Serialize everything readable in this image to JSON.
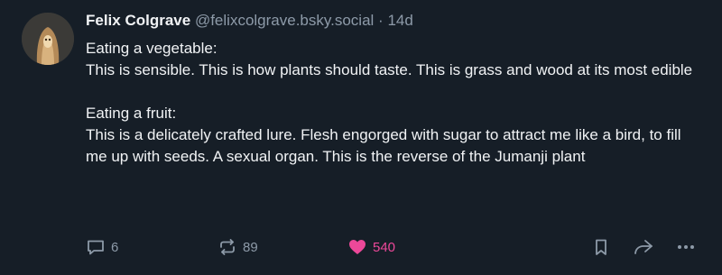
{
  "post": {
    "author": {
      "name": "Felix Colgrave",
      "handle": "@felixcolgrave.bsky.social"
    },
    "separator": "·",
    "age": "14d",
    "paragraphs": [
      {
        "heading": "Eating a vegetable:",
        "text": "This is sensible. This is how plants should taste. This is grass and wood at its most edible"
      },
      {
        "heading": "Eating a fruit:",
        "text": "This is a delicately crafted lure. Flesh engorged with sugar to attract me like a bird, to fill me up with seeds. A sexual organ. This is the reverse of the Jumanji plant"
      }
    ],
    "actions": {
      "replies": "6",
      "reposts": "89",
      "likes": "540",
      "liked": true
    }
  },
  "colors": {
    "background": "#161e27",
    "text": "#f1f3f5",
    "muted": "#8d9aa8",
    "like": "#ec4899"
  },
  "icons": {
    "reply": "speech-bubble-icon",
    "repost": "repost-arrows-icon",
    "like": "heart-icon",
    "bookmark": "bookmark-icon",
    "share": "share-arrow-icon",
    "more": "ellipsis-icon"
  }
}
